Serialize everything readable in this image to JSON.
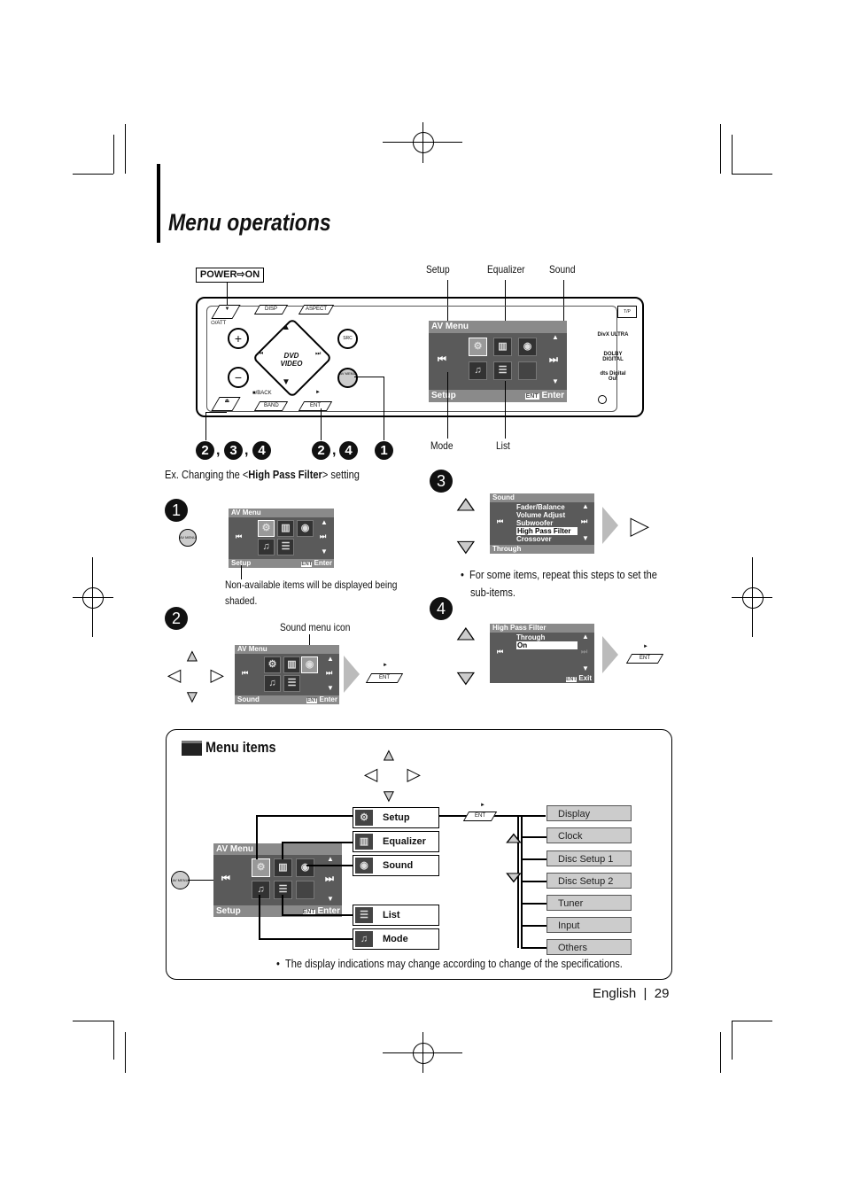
{
  "title": "Menu operations",
  "power_label": "POWER⇨ON",
  "device": {
    "callouts": {
      "setup": "Setup",
      "equalizer": "Equalizer",
      "sound": "Sound",
      "mode": "Mode",
      "list": "List"
    },
    "buttons": {
      "disp": "DISP",
      "aspect": "ASPECT",
      "att": "⏻/ATT",
      "src": "SRC",
      "back": "■/BACK",
      "band": "BAND",
      "ent": "ENT",
      "av_menu": "AV MENU",
      "tp": "T/P",
      "play": "►"
    },
    "logos": {
      "dvd": "DVD VIDEO",
      "divx": "DivX ULTRA",
      "dolby": "DOLBY DIGITAL",
      "dts": "dts Digital Out"
    },
    "screen": {
      "header": "AV Menu",
      "footer": "Setup",
      "enter": "Enter",
      "ent": "ENT"
    }
  },
  "step_refs": {
    "left": [
      "2",
      "3",
      "4"
    ],
    "middle": [
      "2",
      "4"
    ],
    "right": "1"
  },
  "example": {
    "prefix": "Ex. Changing the <",
    "bold": "High Pass Filter",
    "suffix": "> setting"
  },
  "steps": {
    "s1": {
      "num": "1",
      "screen_header": "AV Menu",
      "screen_footer": "Setup",
      "ent": "ENT",
      "enter": "Enter",
      "button": "AV MENU",
      "note_line1": "Non-available items will be displayed being",
      "note_line2": "shaded."
    },
    "s2": {
      "num": "2",
      "callout": "Sound menu icon",
      "screen_header": "AV Menu",
      "screen_footer": "Sound",
      "ent": "ENT",
      "enter": "Enter",
      "button": "ENT"
    },
    "s3": {
      "num": "3",
      "screen_header": "Sound",
      "items": [
        "Fader/Balance",
        "Volume Adjust",
        "Subwoofer",
        "High Pass Filter",
        "Crossover"
      ],
      "selected": "High Pass Filter",
      "screen_footer": "Through",
      "note_line1": "For some items, repeat this steps to set the",
      "note_line2": "sub-items."
    },
    "s4": {
      "num": "4",
      "screen_header": "High Pass Filter",
      "items": [
        "Through",
        "On"
      ],
      "selected": "On",
      "ent": "ENT",
      "exit": "Exit",
      "button": "ENT"
    }
  },
  "menu_items": {
    "heading": "Menu items",
    "screen": {
      "header": "AV Menu",
      "footer": "Setup",
      "ent": "ENT",
      "enter": "Enter",
      "button": "AV MENU"
    },
    "items": [
      {
        "label": "Setup",
        "icon": "gear-icon"
      },
      {
        "label": "Equalizer",
        "icon": "equalizer-icon"
      },
      {
        "label": "Sound",
        "icon": "speaker-icon"
      },
      {
        "label": "List",
        "icon": "list-icon"
      },
      {
        "label": "Mode",
        "icon": "music-note-icon"
      }
    ],
    "ent_button": "ENT",
    "setup_items": [
      "Display",
      "Clock",
      "Disc Setup 1",
      "Disc Setup 2",
      "Tuner",
      "Input",
      "Others"
    ],
    "note": "The display indications may change according to change of the specifications."
  },
  "footer": {
    "language": "English",
    "separator": "|",
    "page": "29"
  }
}
